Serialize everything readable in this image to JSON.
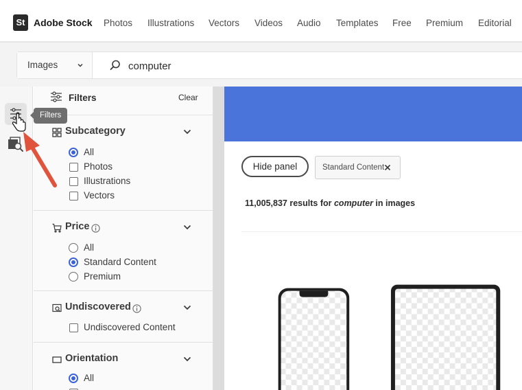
{
  "header": {
    "logo_text": "St",
    "brand": "Adobe Stock",
    "nav": [
      "Photos",
      "Illustrations",
      "Vectors",
      "Videos",
      "Audio",
      "Templates",
      "Free",
      "Premium",
      "Editorial"
    ]
  },
  "search": {
    "type_value": "Images",
    "query": "computer"
  },
  "rail": {
    "tooltip": "Filters",
    "filter_icon": "sliders-icon",
    "similar_icon": "image-search-icon"
  },
  "filters": {
    "title": "Filters",
    "clear": "Clear",
    "sections": [
      {
        "title": "Subcategory",
        "icon": "grid-icon",
        "options": [
          {
            "label": "All",
            "type": "radio",
            "selected": true
          },
          {
            "label": "Photos",
            "type": "checkbox",
            "selected": false
          },
          {
            "label": "Illustrations",
            "type": "checkbox",
            "selected": false
          },
          {
            "label": "Vectors",
            "type": "checkbox",
            "selected": false
          }
        ]
      },
      {
        "title": "Price",
        "icon": "cart-icon",
        "info": true,
        "options": [
          {
            "label": "All",
            "type": "radio",
            "selected": false
          },
          {
            "label": "Standard Content",
            "type": "radio",
            "selected": true
          },
          {
            "label": "Premium",
            "type": "radio",
            "selected": false
          }
        ]
      },
      {
        "title": "Undiscovered",
        "icon": "discover-icon",
        "info": true,
        "options": [
          {
            "label": "Undiscovered Content",
            "type": "checkbox",
            "selected": false
          }
        ]
      },
      {
        "title": "Orientation",
        "icon": "rectangle-icon",
        "options": [
          {
            "label": "All",
            "type": "radio",
            "selected": true
          }
        ]
      }
    ]
  },
  "main": {
    "hide_panel": "Hide panel",
    "chip_label": "Standard Content",
    "results_count": "11,005,837",
    "results_mid": "results for",
    "results_query": "computer",
    "results_in": "in images"
  },
  "colors": {
    "accent": "#3b63d6",
    "banner": "#4a74d9",
    "arrow": "#e0533d"
  }
}
